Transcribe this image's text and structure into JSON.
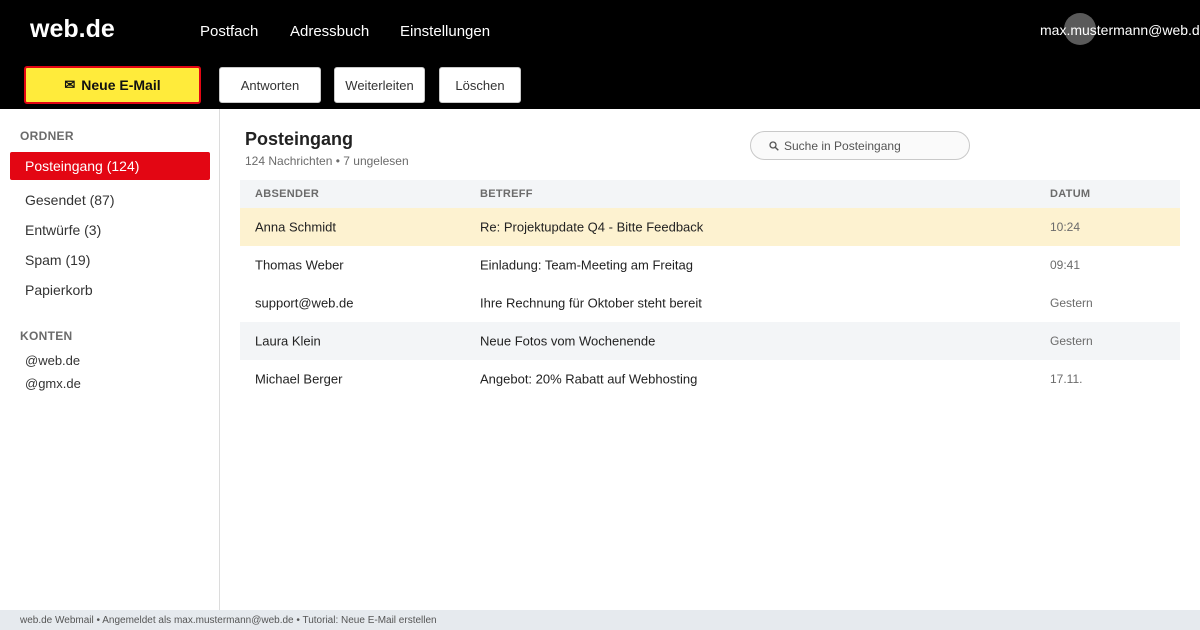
{
  "header": {
    "logo": "web.de",
    "nav": [
      "Postfach",
      "Adressbuch",
      "Einstellungen"
    ],
    "user_email": "max.mustermann@web.de"
  },
  "toolbar": {
    "compose_icon": "✉",
    "compose_label": "Neue E-Mail",
    "reply_label": "Antworten",
    "forward_label": "Weiterleiten",
    "delete_label": "Löschen"
  },
  "sidebar": {
    "folders_heading": "ORDNER",
    "folders": [
      {
        "label": "Posteingang (124)",
        "active": true
      },
      {
        "label": "Gesendet (87)"
      },
      {
        "label": "Entwürfe (3)"
      },
      {
        "label": "Spam (19)"
      },
      {
        "label": "Papierkorb"
      }
    ],
    "accounts_heading": "KONTEN",
    "accounts": [
      "@web.de",
      "@gmx.de"
    ]
  },
  "main": {
    "title": "Posteingang",
    "subtitle": "124 Nachrichten • 7 ungelesen",
    "search_placeholder": "Suche in Posteingang",
    "columns": {
      "sender": "ABSENDER",
      "subject": "BETREFF",
      "date": "DATUM"
    },
    "emails": [
      {
        "sender": "Anna Schmidt",
        "subject": "Re: Projektupdate Q4 - Bitte Feedback",
        "date": "10:24",
        "highlighted": true
      },
      {
        "sender": "Thomas Weber",
        "subject": "Einladung: Team-Meeting am Freitag",
        "date": "09:41"
      },
      {
        "sender": "support@web.de",
        "subject": "Ihre Rechnung für Oktober steht bereit",
        "date": "Gestern"
      },
      {
        "sender": "Laura Klein",
        "subject": "Neue Fotos vom Wochenende",
        "date": "Gestern"
      },
      {
        "sender": "Michael Berger",
        "subject": "Angebot: 20% Rabatt auf Webhosting",
        "date": "17.11."
      }
    ]
  },
  "footer": {
    "text": "web.de Webmail • Angemeldet als max.mustermann@web.de • Tutorial: Neue E-Mail erstellen"
  },
  "colors": {
    "accent_red": "#e30613",
    "compose_yellow": "#ffeb3b",
    "highlight_row": "#fdf2d0",
    "header_black": "#000000"
  },
  "icons": {
    "compose": "envelope-icon",
    "search": "search-icon"
  }
}
